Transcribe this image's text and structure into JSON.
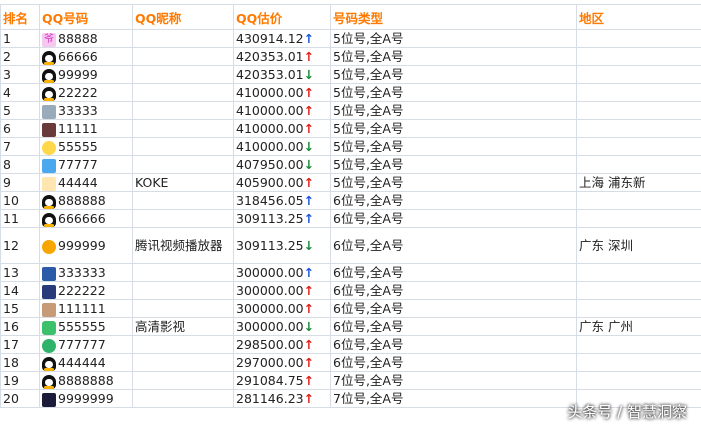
{
  "header": {
    "rank": "排名",
    "qq": "QQ号码",
    "nick": "QQ昵称",
    "value": "QQ估价",
    "type": "号码类型",
    "region": "地区"
  },
  "rows": [
    {
      "rank": "1",
      "qq": "88888",
      "nick": "",
      "value": "430914.12",
      "trend": "↑",
      "type": "5位号,全A号",
      "region": ""
    },
    {
      "rank": "2",
      "qq": "66666",
      "nick": "",
      "value": "420353.01",
      "trend": "↑",
      "type": "5位号,全A号",
      "region": ""
    },
    {
      "rank": "3",
      "qq": "99999",
      "nick": "",
      "value": "420353.01",
      "trend": "↓",
      "type": "5位号,全A号",
      "region": ""
    },
    {
      "rank": "4",
      "qq": "22222",
      "nick": "",
      "value": "410000.00",
      "trend": "↑",
      "type": "5位号,全A号",
      "region": ""
    },
    {
      "rank": "5",
      "qq": "33333",
      "nick": "",
      "value": "410000.00",
      "trend": "↑",
      "type": "5位号,全A号",
      "region": ""
    },
    {
      "rank": "6",
      "qq": "11111",
      "nick": "",
      "value": "410000.00",
      "trend": "↑",
      "type": "5位号,全A号",
      "region": ""
    },
    {
      "rank": "7",
      "qq": "55555",
      "nick": "",
      "value": "410000.00",
      "trend": "↓",
      "type": "5位号,全A号",
      "region": ""
    },
    {
      "rank": "8",
      "qq": "77777",
      "nick": "",
      "value": "407950.00",
      "trend": "↓",
      "type": "5位号,全A号",
      "region": ""
    },
    {
      "rank": "9",
      "qq": "44444",
      "nick": "KOKE",
      "value": "405900.00",
      "trend": "↑",
      "type": "5位号,全A号",
      "region": "上海 浦东新"
    },
    {
      "rank": "10",
      "qq": "888888",
      "nick": "",
      "value": "318456.05",
      "trend": "↑",
      "type": "6位号,全A号",
      "region": ""
    },
    {
      "rank": "11",
      "qq": "666666",
      "nick": "",
      "value": "309113.25",
      "trend": "↑",
      "type": "6位号,全A号",
      "region": ""
    },
    {
      "rank": "12",
      "qq": "999999",
      "nick": "腾讯视频播放器",
      "value": "309113.25",
      "trend": "↓",
      "type": "6位号,全A号",
      "region": "广东 深圳"
    },
    {
      "rank": "13",
      "qq": "333333",
      "nick": "",
      "value": "300000.00",
      "trend": "↑",
      "type": "6位号,全A号",
      "region": ""
    },
    {
      "rank": "14",
      "qq": "222222",
      "nick": "",
      "value": "300000.00",
      "trend": "↑",
      "type": "6位号,全A号",
      "region": ""
    },
    {
      "rank": "15",
      "qq": "111111",
      "nick": "",
      "value": "300000.00",
      "trend": "↑",
      "type": "6位号,全A号",
      "region": ""
    },
    {
      "rank": "16",
      "qq": "555555",
      "nick": "高清影视",
      "value": "300000.00",
      "trend": "↓",
      "type": "6位号,全A号",
      "region": "广东 广州"
    },
    {
      "rank": "17",
      "qq": "777777",
      "nick": "",
      "value": "298500.00",
      "trend": "↑",
      "type": "6位号,全A号",
      "region": ""
    },
    {
      "rank": "18",
      "qq": "444444",
      "nick": "",
      "value": "297000.00",
      "trend": "↑",
      "type": "6位号,全A号",
      "region": ""
    },
    {
      "rank": "19",
      "qq": "8888888",
      "nick": "",
      "value": "291084.75",
      "trend": "↑",
      "type": "7位号,全A号",
      "region": ""
    },
    {
      "rank": "20",
      "qq": "9999999",
      "nick": "",
      "value": "281146.23",
      "trend": "↑",
      "type": "7位号,全A号",
      "region": ""
    }
  ],
  "avatars": [
    "pink",
    "penguin",
    "penguin",
    "penguin",
    "pixel",
    "photo",
    "cat",
    "sky",
    "baby",
    "penguin",
    "penguin",
    "video",
    "fb",
    "anime",
    "girl",
    "play",
    "green",
    "penguin",
    "penguin",
    "night"
  ],
  "watermark": "头条号 / 智慧洞察",
  "colors": {
    "header": "#ff7a00",
    "up": "#e0201a",
    "down": "#1b8a3a"
  }
}
